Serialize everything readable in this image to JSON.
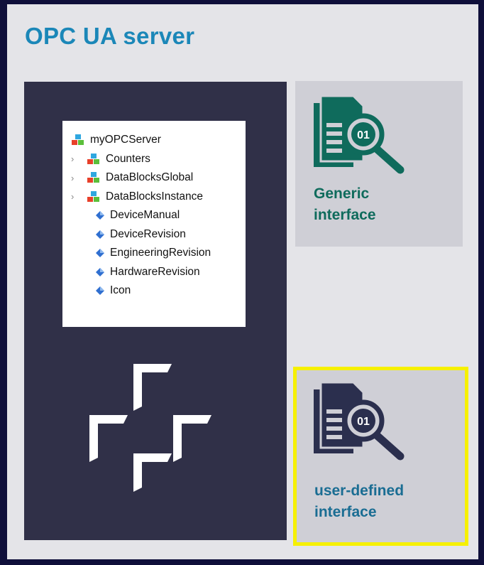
{
  "title": "OPC UA server",
  "tree": {
    "root": "myOPCServer",
    "items": [
      {
        "label": "Counters",
        "type": "folder",
        "expandable": true
      },
      {
        "label": "DataBlocksGlobal",
        "type": "folder",
        "expandable": true
      },
      {
        "label": "DataBlocksInstance",
        "type": "folder",
        "expandable": true
      },
      {
        "label": "DeviceManual",
        "type": "property",
        "expandable": false
      },
      {
        "label": "DeviceRevision",
        "type": "property",
        "expandable": false
      },
      {
        "label": "EngineeringRevision",
        "type": "property",
        "expandable": false
      },
      {
        "label": "HardwareRevision",
        "type": "property",
        "expandable": false
      },
      {
        "label": "Icon",
        "type": "property",
        "expandable": false
      }
    ]
  },
  "generic": {
    "line1": "Generic",
    "line2": "interface",
    "icon": "document-search-icon",
    "badge": "01",
    "color": "#0f6b5c"
  },
  "user_defined": {
    "line1": "user-defined",
    "line2": "interface",
    "icon": "document-search-icon",
    "badge": "01",
    "color": "#2b2f4e",
    "highlight": "#f6f000"
  },
  "colors": {
    "title": "#1b87b8",
    "dark_panel": "#303048",
    "background": "#e4e4e8"
  }
}
